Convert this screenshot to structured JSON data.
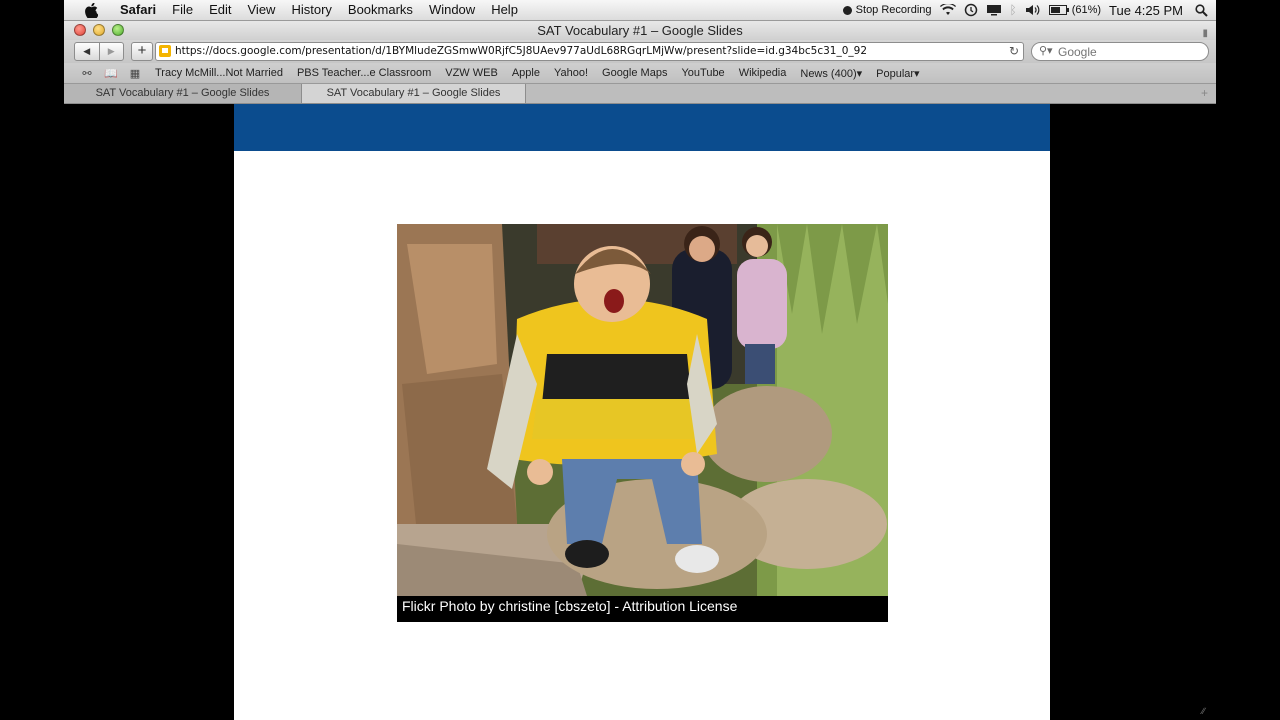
{
  "menubar": {
    "app_name": "Safari",
    "items": [
      "File",
      "Edit",
      "View",
      "History",
      "Bookmarks",
      "Window",
      "Help"
    ],
    "status": {
      "recording": "Stop Recording",
      "battery": "(61%)",
      "clock": "Tue 4:25 PM"
    }
  },
  "window": {
    "title": "SAT Vocabulary #1 – Google Slides"
  },
  "toolbar": {
    "url": "https://docs.google.com/presentation/d/1BYMludeZGSmwW0RjfC5J8UAev977aUdL68RGqrLMjWw/present?slide=id.g34bc5c31_0_92",
    "search_placeholder": "Google"
  },
  "bookmarks": [
    "Tracy McMill...Not Married",
    "PBS Teacher...e Classroom",
    "VZW WEB",
    "Apple",
    "Yahoo!",
    "Google Maps",
    "YouTube",
    "Wikipedia",
    "News (400)▾",
    "Popular▾"
  ],
  "tabs": [
    {
      "label": "SAT Vocabulary #1 – Google Slides"
    },
    {
      "label": "SAT Vocabulary #1 – Google Slides"
    }
  ],
  "slide": {
    "header_color": "#0b4c8e",
    "photo_caption": "Flickr Photo by christine [cbszeto] - Attribution License"
  }
}
